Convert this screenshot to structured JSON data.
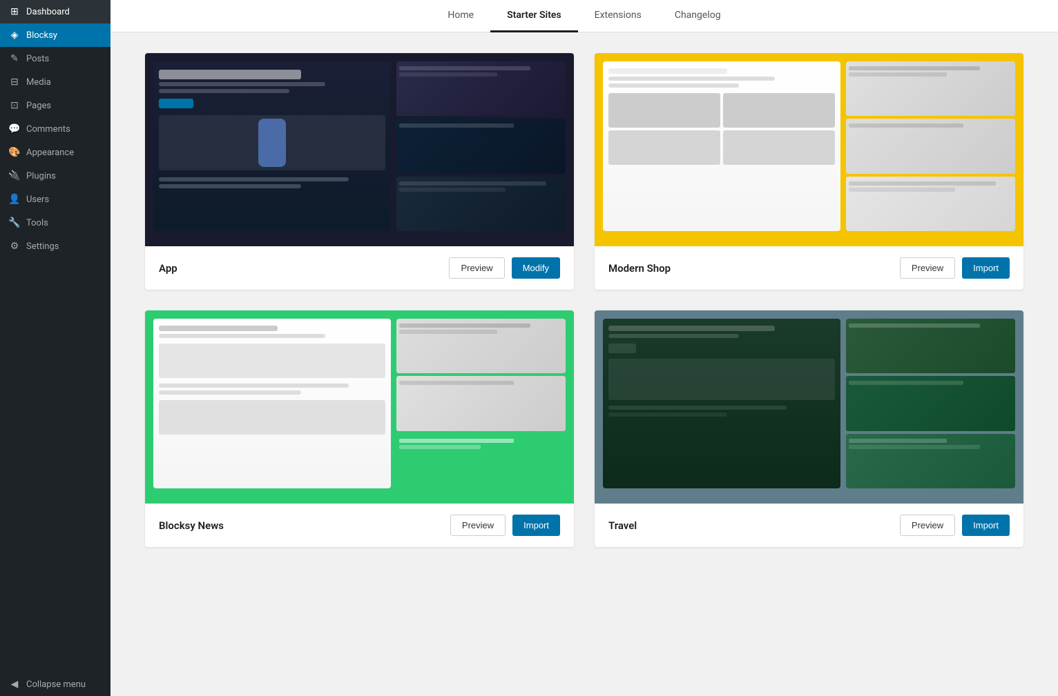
{
  "sidebar": {
    "items": [
      {
        "id": "dashboard",
        "label": "Dashboard",
        "icon": "⊞"
      },
      {
        "id": "blocksy",
        "label": "Blocksy",
        "icon": "◈",
        "active": true
      },
      {
        "id": "posts",
        "label": "Posts",
        "icon": "✎"
      },
      {
        "id": "media",
        "label": "Media",
        "icon": "⊟"
      },
      {
        "id": "pages",
        "label": "Pages",
        "icon": "⊡"
      },
      {
        "id": "comments",
        "label": "Comments",
        "icon": "💬"
      },
      {
        "id": "appearance",
        "label": "Appearance",
        "icon": "🎨"
      },
      {
        "id": "plugins",
        "label": "Plugins",
        "icon": "🔌"
      },
      {
        "id": "users",
        "label": "Users",
        "icon": "👤"
      },
      {
        "id": "tools",
        "label": "Tools",
        "icon": "🔧"
      },
      {
        "id": "settings",
        "label": "Settings",
        "icon": "⚙"
      },
      {
        "id": "collapse",
        "label": "Collapse menu",
        "icon": "◀"
      }
    ]
  },
  "tabs": [
    {
      "id": "home",
      "label": "Home"
    },
    {
      "id": "starter-sites",
      "label": "Starter Sites",
      "active": true
    },
    {
      "id": "extensions",
      "label": "Extensions"
    },
    {
      "id": "changelog",
      "label": "Changelog"
    }
  ],
  "sites": [
    {
      "id": "app",
      "name": "App",
      "theme": "app",
      "actions": {
        "preview": "Preview",
        "primary": "Modify",
        "primary_type": "modify"
      }
    },
    {
      "id": "modern-shop",
      "name": "Modern Shop",
      "theme": "shop",
      "actions": {
        "preview": "Preview",
        "primary": "Import",
        "primary_type": "import"
      }
    },
    {
      "id": "blocksy-news",
      "name": "Blocksy News",
      "theme": "news",
      "actions": {
        "preview": "Preview",
        "primary": "Import",
        "primary_type": "import"
      }
    },
    {
      "id": "travel",
      "name": "Travel",
      "theme": "travel",
      "actions": {
        "preview": "Preview",
        "primary": "Import",
        "primary_type": "import"
      }
    }
  ]
}
